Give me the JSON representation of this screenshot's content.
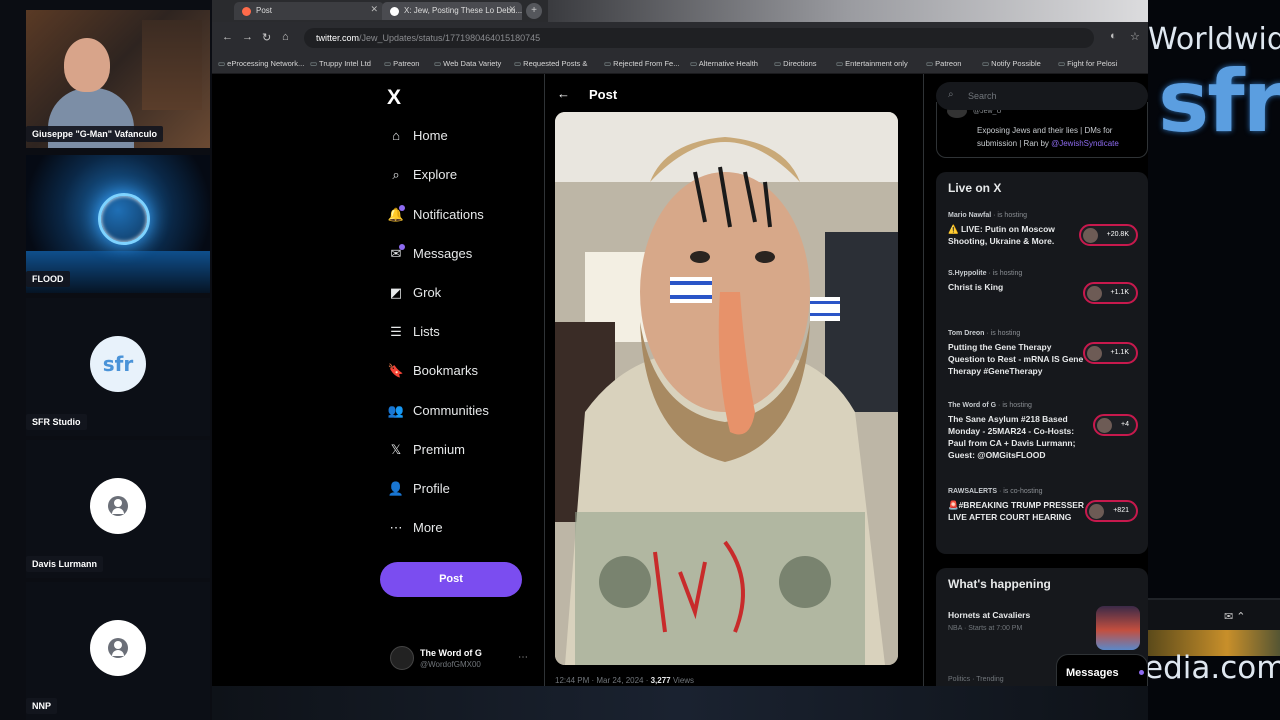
{
  "participants": [
    {
      "name": "Giuseppe \"G-Man\" Vafanculo"
    },
    {
      "name": "FLOOD"
    },
    {
      "name": "SFR Studio",
      "logo": "sfr"
    },
    {
      "name": "Davis Lurmann"
    },
    {
      "name": "NNP"
    }
  ],
  "browser": {
    "tabs": [
      {
        "label": "Post"
      },
      {
        "label": "X: Jew, Posting These Lo Debu..."
      }
    ],
    "url_host": "twitter.com",
    "url_rest": "/Jew_Updates/status/1771980464015180745",
    "bookmarks": [
      "eProcessing Network...",
      "Truppy Intel Ltd",
      "Patreon",
      "Web Data Variety",
      "Requested Posts &",
      "Rejected From Fe...",
      "Alternative Health",
      "Directions",
      "Entertainment only",
      "Patreon",
      "Notify Possible",
      "Fight for Pelosi"
    ]
  },
  "x": {
    "logo": "X",
    "nav": [
      {
        "label": "Home",
        "icon": "home-icon",
        "glyph": "⌂"
      },
      {
        "label": "Explore",
        "icon": "search-icon",
        "glyph": "⌕"
      },
      {
        "label": "Notifications",
        "icon": "bell-icon",
        "glyph": "🔔"
      },
      {
        "label": "Messages",
        "icon": "mail-icon",
        "glyph": "✉"
      },
      {
        "label": "Grok",
        "icon": "grok-icon",
        "glyph": "◩"
      },
      {
        "label": "Lists",
        "icon": "list-icon",
        "glyph": "☰"
      },
      {
        "label": "Bookmarks",
        "icon": "bookmark-icon",
        "glyph": "🔖"
      },
      {
        "label": "Communities",
        "icon": "communities-icon",
        "glyph": "👥"
      },
      {
        "label": "Premium",
        "icon": "x-premium-icon",
        "glyph": "𝕏"
      },
      {
        "label": "Profile",
        "icon": "person-icon",
        "glyph": "👤"
      },
      {
        "label": "More",
        "icon": "more-icon",
        "glyph": "⋯"
      }
    ],
    "post_button": "Post",
    "account": {
      "name": "The Word of G",
      "handle": "@WordofGMX00"
    },
    "main": {
      "title": "Post",
      "meta_time": "12:44 PM · Mar 24, 2024 · ",
      "meta_views": "3,277",
      "meta_views_label": " Views"
    },
    "search_placeholder": "Search",
    "profile_card": {
      "name": "@Jew_U",
      "bio": "Exposing Jews and their lies | DMs for submission | Ran by ",
      "bio_link": "@JewishSyndicate"
    },
    "live": {
      "title": "Live on X",
      "items": [
        {
          "host": "Mario Nawfal",
          "status": "is hosting",
          "title": "⚠️ LIVE: Putin on Moscow Shooting, Ukraine & More.",
          "count": "+20.8K"
        },
        {
          "host": "S.Hyppolite",
          "status": "is hosting",
          "title": "Christ is King",
          "count": "+1.1K"
        },
        {
          "host": "Tom Dreon",
          "status": "is hosting",
          "title": "Putting the Gene Therapy Question to Rest - mRNA IS Gene Therapy #GeneTherapy",
          "count": "+1.1K"
        },
        {
          "host": "The Word of G",
          "status": "is hosting",
          "title": "The Sane Asylum #218 Based Monday - 25MAR24 - Co-Hosts: Paul from CA + Davis Lurmann; Guest: @OMGitsFLOOD",
          "count": "+4"
        },
        {
          "host": "RAWSALERTS",
          "status": "is co-hosting",
          "title": "🚨#BREAKING TRUMP PRESSER LIVE AFTER COURT HEARING",
          "count": "+821"
        }
      ]
    },
    "happening": {
      "title": "What's happening",
      "items": [
        {
          "title": "Hornets at Cavaliers",
          "sub": "NBA · Starts at 7:00 PM"
        }
      ],
      "next": "Politics · Trending"
    },
    "messages_drawer": "Messages"
  },
  "overlay": {
    "worldwide": "Worldwide",
    "logo": "sfr",
    "media": "edia.com"
  }
}
